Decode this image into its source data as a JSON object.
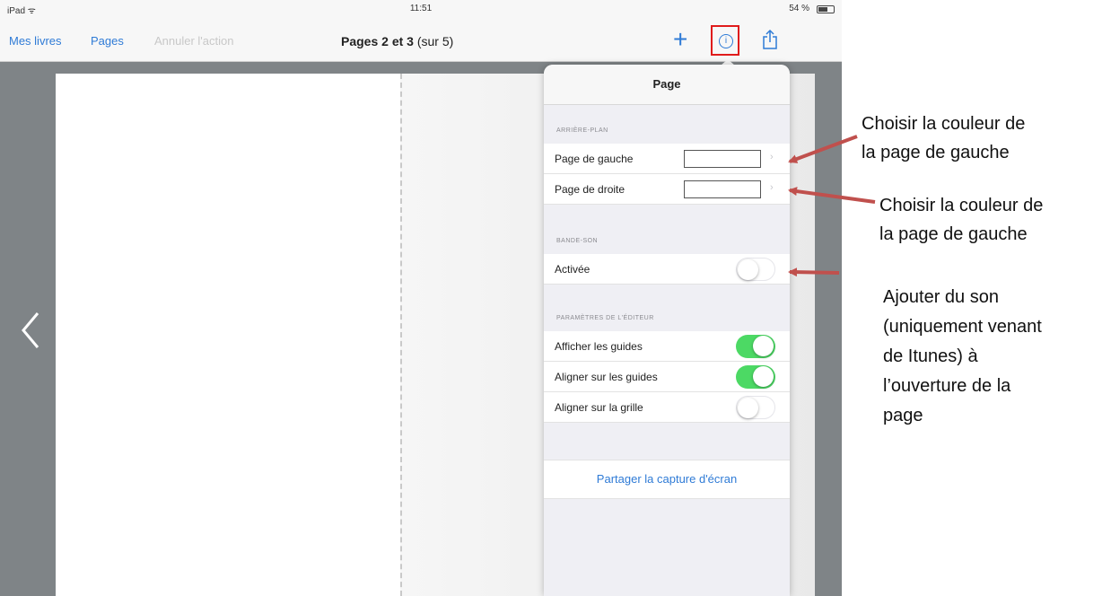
{
  "status_bar": {
    "device": "iPad ᯤ",
    "time": "11:51",
    "battery": "54 %"
  },
  "nav": {
    "my_books": "Mes livres",
    "pages": "Pages",
    "undo": "Annuler l'action",
    "title_bold": "Pages 2 et 3",
    "title_suffix": " (sur 5)"
  },
  "panel": {
    "title": "Page",
    "sections": {
      "background": "ARRIÈRE-PLAN",
      "soundtrack": "BANDE-SON",
      "editor": "PARAMÈTRES DE L'ÉDITEUR"
    },
    "rows": {
      "left_page": "Page de gauche",
      "right_page": "Page de droite",
      "activated": "Activée",
      "show_guides": "Afficher les guides",
      "snap_guides": "Aligner sur les guides",
      "snap_grid": "Aligner sur la grille"
    },
    "toggles": {
      "activated": false,
      "show_guides": true,
      "snap_guides": true,
      "snap_grid": false
    },
    "colors": {
      "left_page": "#ffffff",
      "right_page": "#ffffff"
    },
    "share": "Partager la capture d'écran"
  },
  "annotations": {
    "a1_l1": "Choisir la couleur de",
    "a1_l2": "la page de gauche",
    "a2_l1": "Choisir la couleur de",
    "a2_l2": "la page de gauche",
    "a3_l1": "Ajouter du son",
    "a3_l2": "(uniquement venant",
    "a3_l3": "de Itunes) à",
    "a3_l4": "l’ouverture de la",
    "a3_l5": "page"
  },
  "icons": [
    "wifi-icon",
    "battery-icon",
    "plus-icon",
    "info-icon",
    "share-icon",
    "chevron-left-icon",
    "disclosure-icon"
  ],
  "colors": {
    "accent": "#2f7bd6",
    "toggle_on": "#4cd964",
    "highlight": "#e01b1b",
    "arrow": "#c0504d"
  }
}
